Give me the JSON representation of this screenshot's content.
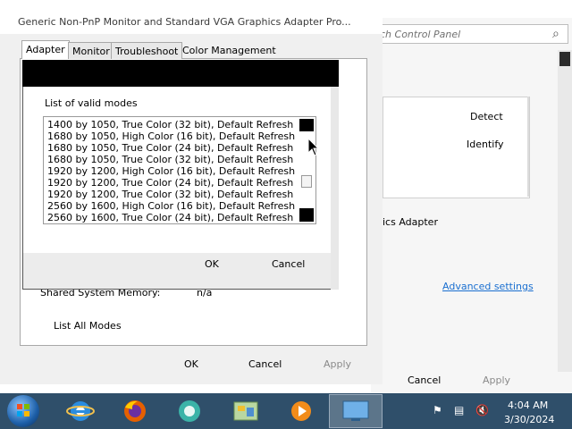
{
  "background_window": {
    "search_placeholder": "ch Control Panel",
    "detect_label": "Detect",
    "identify_label": "Identify",
    "adapter_text": "ics Adapter",
    "advanced_link": "Advanced settings",
    "cancel_label": "Cancel",
    "apply_label": "Apply"
  },
  "properties_window": {
    "title": "Generic Non-PnP Monitor and Standard VGA Graphics Adapter Pro...",
    "tabs": [
      {
        "label": "Adapter",
        "active": true
      },
      {
        "label": "Monitor",
        "active": false
      },
      {
        "label": "Troubleshoot",
        "active": false
      },
      {
        "label": "Color Management",
        "active": false
      }
    ],
    "shared_memory_label": "Shared System Memory:",
    "shared_memory_value": "n/a",
    "list_all_modes_label": "List All Modes",
    "ok_label": "OK",
    "cancel_label": "Cancel",
    "apply_label": "Apply"
  },
  "modes_dialog": {
    "list_label": "List of valid modes",
    "modes": [
      "1400 by 1050, True Color (32 bit), Default Refresh",
      "1680 by 1050, High Color (16 bit), Default Refresh",
      "1680 by 1050, True Color (24 bit), Default Refresh",
      "1680 by 1050, True Color (32 bit), Default Refresh",
      "1920 by 1200, High Color (16 bit), Default Refresh",
      "1920 by 1200, True Color (24 bit), Default Refresh",
      "1920 by 1200, True Color (32 bit), Default Refresh",
      "2560 by 1600, High Color (16 bit), Default Refresh",
      "2560 by 1600, True Color (24 bit), Default Refresh"
    ],
    "ok_label": "OK",
    "cancel_label": "Cancel"
  },
  "taskbar": {
    "items": [
      "start-button",
      "internet-explorer-icon",
      "firefox-icon",
      "media-app-icon",
      "control-panel-icon",
      "media-player-icon",
      "display-settings-icon"
    ],
    "tray_icons": [
      "flag-icon",
      "network-icon",
      "volume-muted-icon"
    ],
    "time": "4:04 AM",
    "date": "3/30/2024"
  },
  "colors": {
    "taskbar": "#2f4f6a",
    "link": "#1a6fd0",
    "disabled_text": "#8a8a8a"
  }
}
